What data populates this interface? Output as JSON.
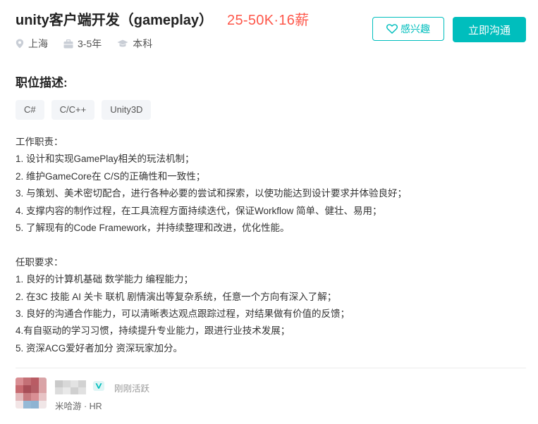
{
  "job": {
    "title": "unity客户端开发（gameplay）",
    "salary": "25-50K·16薪",
    "location": "上海",
    "experience": "3-5年",
    "degree": "本科"
  },
  "actions": {
    "interest_label": "感兴趣",
    "chat_label": "立即沟通"
  },
  "colors": {
    "accent": "#00bebd",
    "salary": "#fe574a"
  },
  "description": {
    "section_title": "职位描述:",
    "tags": [
      "C#",
      "C/C++",
      "Unity3D"
    ],
    "lines": [
      "工作职责：",
      "1. 设计和实现GamePlay相关的玩法机制；",
      "2. 维护GameCore在 C/S的正确性和一致性；",
      "3. 与策划、美术密切配合，进行各种必要的尝试和探索，以使功能达到设计要求并体验良好；",
      "4. 支撑内容的制作过程，在工具流程方面持续迭代，保证Workflow 简单、健壮、易用；",
      "5. 了解现有的Code Framework，并持续整理和改进，优化性能。",
      "",
      "任职要求：",
      "1. 良好的计算机基础 数学能力 编程能力；",
      "2. 在3C 技能 AI 关卡 联机 剧情演出等复杂系统，任意一个方向有深入了解；",
      "3. 良好的沟通合作能力，可以清晰表达观点跟踪过程，对结果做有价值的反馈；",
      "4.有自驱动的学习习惯，持续提升专业能力，跟进行业技术发展；",
      "5. 资深ACG爱好者加分 资深玩家加分。"
    ]
  },
  "recruiter": {
    "status": "刚刚活跃",
    "company_role": "米哈游 · HR",
    "verified_icon": "verified-v-icon",
    "avatar_icon": "pixelated-avatar"
  }
}
